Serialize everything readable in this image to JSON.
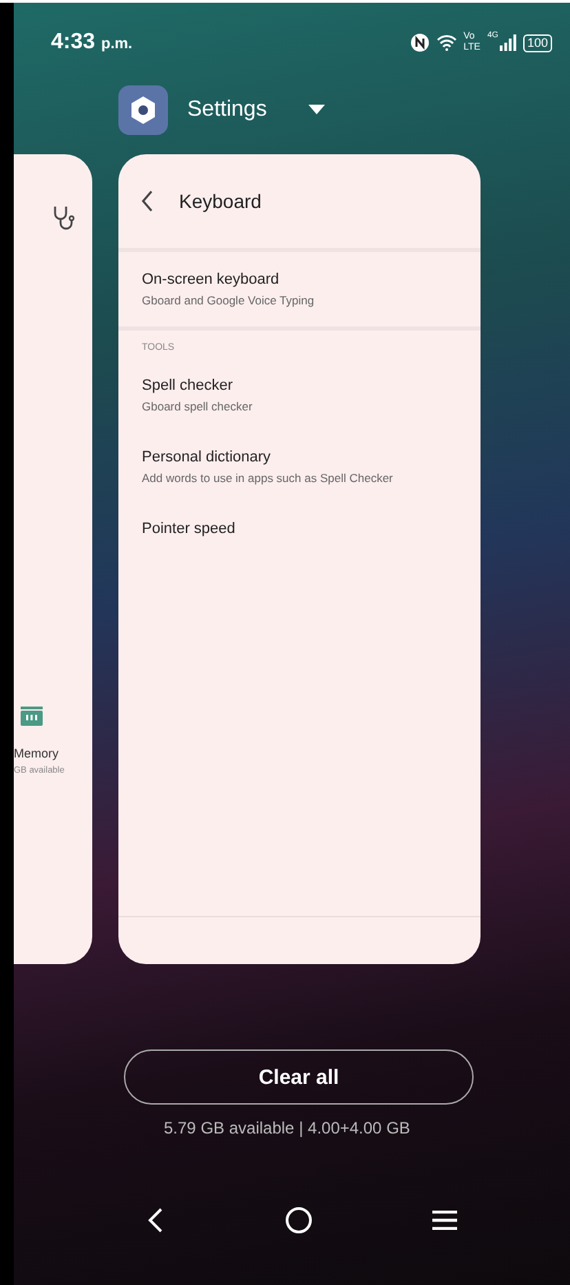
{
  "status_bar": {
    "time": "4:33",
    "period": "p.m.",
    "volte_top": "Vo",
    "volte_bottom": "LTE",
    "network": "4G",
    "battery": "100"
  },
  "app_header": {
    "title": "Settings"
  },
  "side_card": {
    "title": "Memory",
    "subtitle": "GB available"
  },
  "main_card": {
    "title": "Keyboard",
    "items": [
      {
        "kind": "item",
        "title": "On-screen keyboard",
        "subtitle": "Gboard and Google Voice Typing"
      },
      {
        "kind": "header",
        "title": "TOOLS"
      },
      {
        "kind": "item",
        "title": "Spell checker",
        "subtitle": "Gboard spell checker"
      },
      {
        "kind": "item",
        "title": "Personal dictionary",
        "subtitle": "Add words to use in apps such as Spell Checker"
      },
      {
        "kind": "item",
        "title": "Pointer speed"
      }
    ]
  },
  "clear_button": {
    "label": "Clear all"
  },
  "memory_info": "5.79 GB available | 4.00+4.00 GB"
}
